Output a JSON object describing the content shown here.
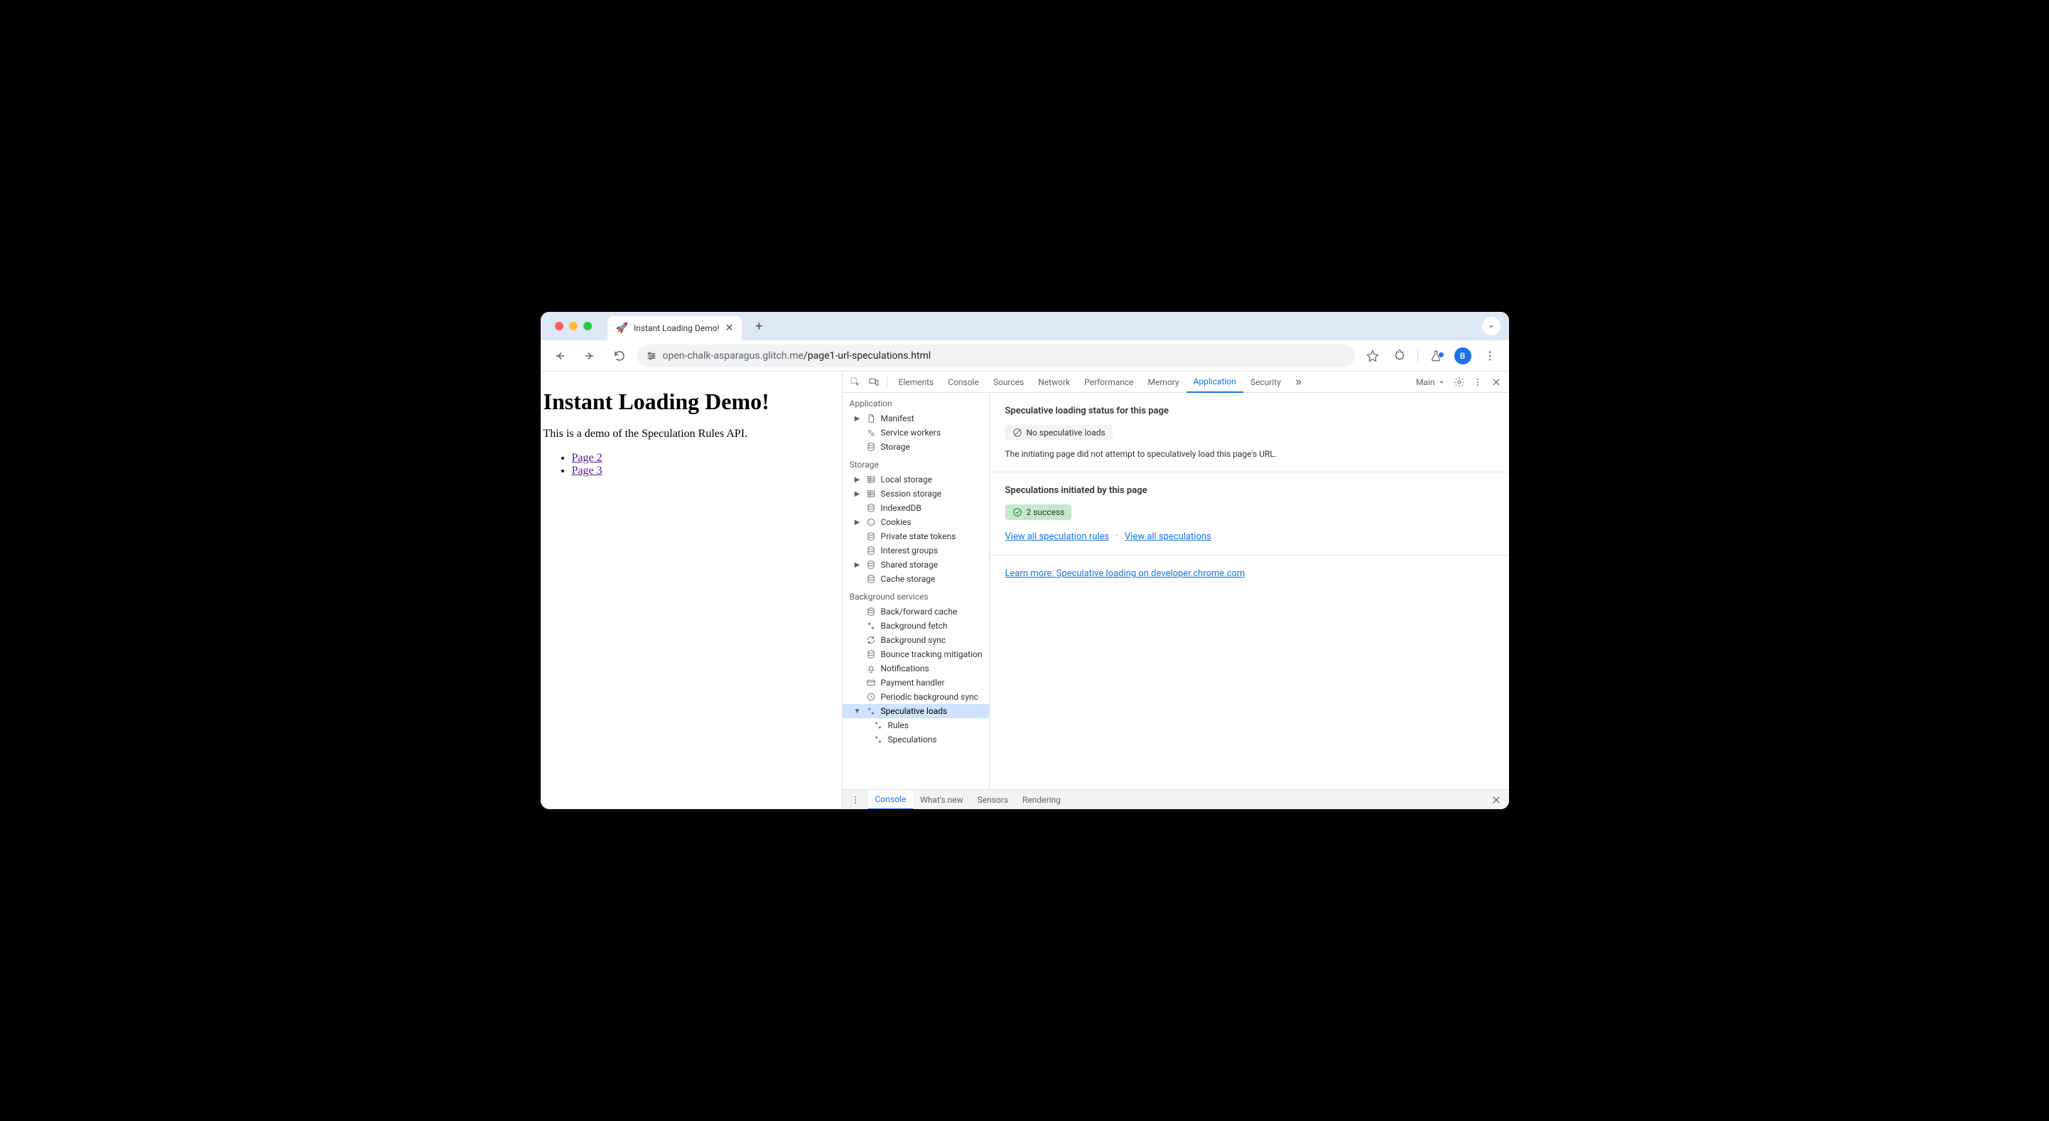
{
  "browser": {
    "tab": {
      "favicon": "🚀",
      "title": "Instant Loading Demo!"
    },
    "url_host": "open-chalk-asparagus.glitch.me",
    "url_path": "/page1-url-speculations.html",
    "avatar_letter": "B"
  },
  "page": {
    "h1": "Instant Loading Demo!",
    "intro": "This is a demo of the Speculation Rules API.",
    "links": [
      "Page 2",
      "Page 3"
    ]
  },
  "devtools": {
    "tabs": [
      "Elements",
      "Console",
      "Sources",
      "Network",
      "Performance",
      "Memory",
      "Application",
      "Security"
    ],
    "active_tab": "Application",
    "frame_select": "Main",
    "sidebar": {
      "sections": [
        {
          "title": "Application",
          "items": [
            {
              "label": "Manifest",
              "icon": "file",
              "expandable": true
            },
            {
              "label": "Service workers",
              "icon": "gears"
            },
            {
              "label": "Storage",
              "icon": "db"
            }
          ]
        },
        {
          "title": "Storage",
          "items": [
            {
              "label": "Local storage",
              "icon": "table",
              "expandable": true
            },
            {
              "label": "Session storage",
              "icon": "table",
              "expandable": true
            },
            {
              "label": "IndexedDB",
              "icon": "db"
            },
            {
              "label": "Cookies",
              "icon": "cookie",
              "expandable": true
            },
            {
              "label": "Private state tokens",
              "icon": "db"
            },
            {
              "label": "Interest groups",
              "icon": "db"
            },
            {
              "label": "Shared storage",
              "icon": "db",
              "expandable": true
            },
            {
              "label": "Cache storage",
              "icon": "db"
            }
          ]
        },
        {
          "title": "Background services",
          "items": [
            {
              "label": "Back/forward cache",
              "icon": "db"
            },
            {
              "label": "Background fetch",
              "icon": "updown"
            },
            {
              "label": "Background sync",
              "icon": "sync"
            },
            {
              "label": "Bounce tracking mitigation",
              "icon": "db"
            },
            {
              "label": "Notifications",
              "icon": "bell"
            },
            {
              "label": "Payment handler",
              "icon": "card"
            },
            {
              "label": "Periodic background sync",
              "icon": "clock"
            },
            {
              "label": "Speculative loads",
              "icon": "updown",
              "expandable": true,
              "expanded": true,
              "selected": true,
              "children": [
                {
                  "label": "Rules",
                  "icon": "updown"
                },
                {
                  "label": "Speculations",
                  "icon": "updown"
                }
              ]
            }
          ]
        }
      ]
    },
    "main": {
      "status_title": "Speculative loading status for this page",
      "status_badge": "No speculative loads",
      "status_desc": "The initiating page did not attempt to speculatively load this page's URL.",
      "initiated_title": "Speculations initiated by this page",
      "initiated_badge": "2 success",
      "link_rules": "View all speculation rules",
      "link_specs": "View all speculations",
      "learn_more": "Learn more: Speculative loading on developer.chrome.com"
    },
    "drawer": {
      "tabs": [
        "Console",
        "What's new",
        "Sensors",
        "Rendering"
      ],
      "active": "Console"
    }
  }
}
